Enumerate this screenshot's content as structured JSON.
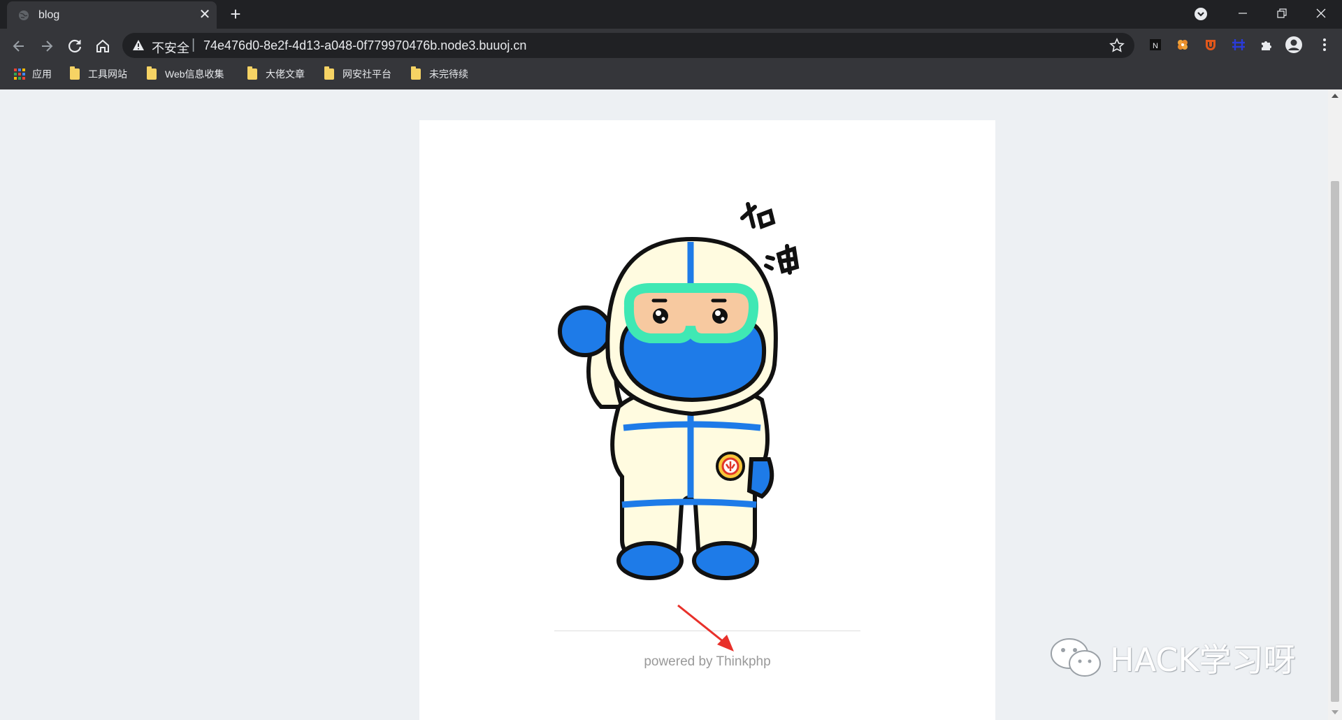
{
  "browser": {
    "tab": {
      "title": "blog",
      "close": "✕"
    },
    "new_tab": "+",
    "address": {
      "security_label": "不安全",
      "separator": "|",
      "url": "74e476d0-8e2f-4d13-a048-0f779970476b.node3.buuoj.cn"
    },
    "bookmarks": [
      {
        "label": "应用",
        "icon": "apps-grid-icon"
      },
      {
        "label": "工具网站",
        "icon": "folder-icon"
      },
      {
        "label": "Web信息收集",
        "icon": "folder-icon"
      },
      {
        "label": "大佬文章",
        "icon": "folder-icon"
      },
      {
        "label": "网安社平台",
        "icon": "folder-icon"
      },
      {
        "label": "未完待续",
        "icon": "folder-icon"
      }
    ]
  },
  "page": {
    "footer_text": "powered by Thinkphp"
  },
  "watermark": {
    "text": "HACK学习呀",
    "icon": "wechat-icon"
  },
  "colors": {
    "tabstrip": "#202124",
    "toolbar": "#35363a",
    "page_bg": "#edf0f3",
    "suit_blue": "#1e7be8",
    "goggle_green": "#3fe8b4",
    "arrow_red": "#e8302a"
  }
}
